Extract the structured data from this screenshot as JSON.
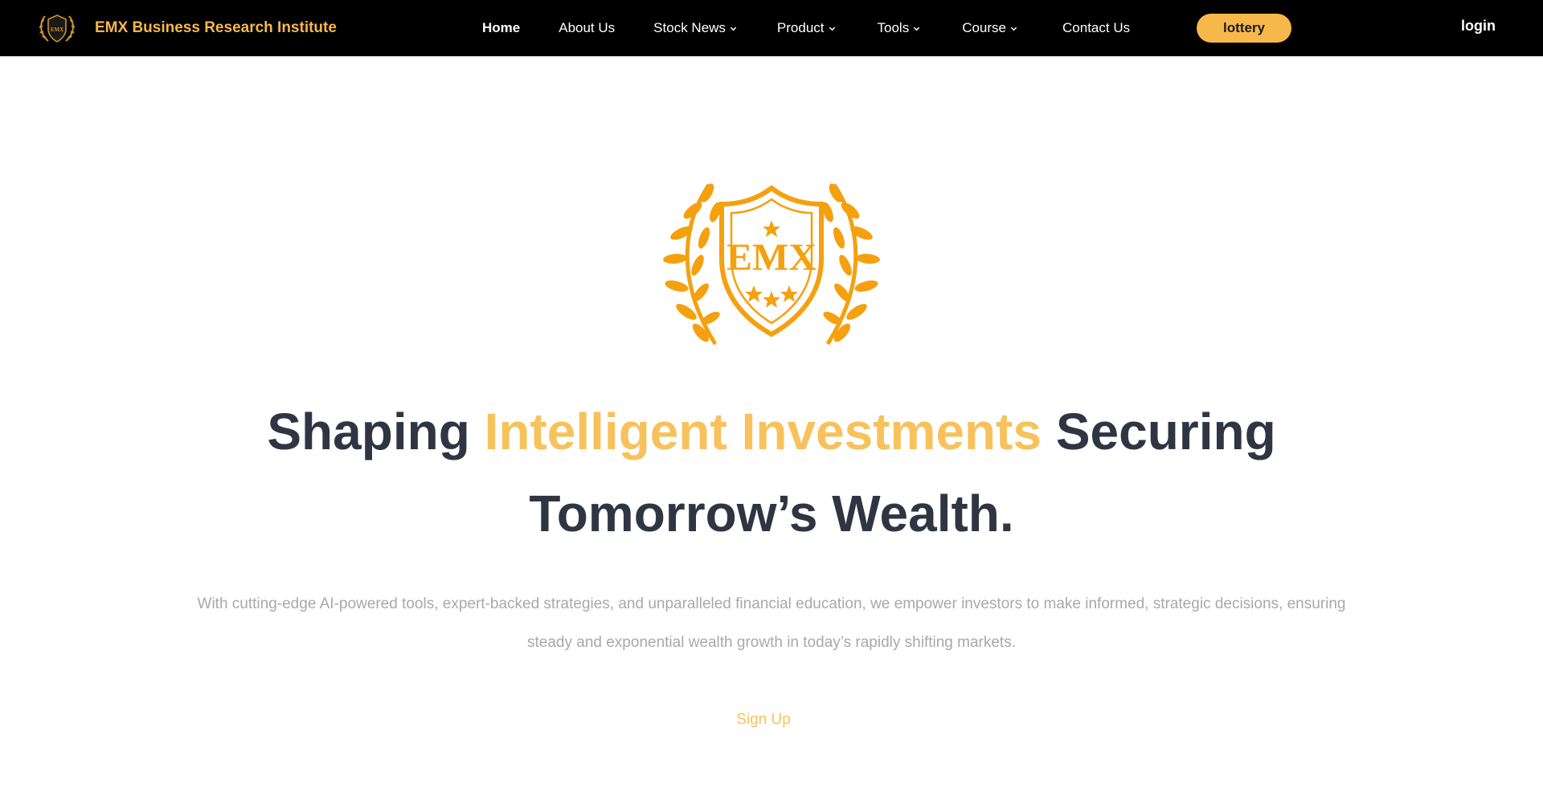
{
  "header": {
    "brand_name": "EMX Business Research Institute",
    "logo_icon": "emx-laurel-shield-icon",
    "nav": [
      {
        "label": "Home",
        "active": true,
        "has_dropdown": false
      },
      {
        "label": "About Us",
        "active": false,
        "has_dropdown": false
      },
      {
        "label": "Stock News",
        "active": false,
        "has_dropdown": true
      },
      {
        "label": "Product",
        "active": false,
        "has_dropdown": true
      },
      {
        "label": "Tools",
        "active": false,
        "has_dropdown": true
      },
      {
        "label": "Course",
        "active": false,
        "has_dropdown": true
      },
      {
        "label": "Contact Us",
        "active": false,
        "has_dropdown": false
      }
    ],
    "lottery_label": "lottery",
    "login_label": "login"
  },
  "hero": {
    "emblem_text": "EMX",
    "headline_part1": "Shaping ",
    "headline_accent": "Intelligent Investments",
    "headline_part2": " Securing Tomorrow’s Wealth.",
    "subtext": "With cutting-edge AI-powered tools, expert-backed strategies, and unparalleled financial education, we empower investors to make informed, strategic decisions, ensuring steady and exponential wealth growth in today’s rapidly shifting markets.",
    "signup_label": "Sign Up"
  },
  "colors": {
    "header_bg": "#000000",
    "brand_gold": "#f7b84b",
    "accent_gold": "#f7c25c",
    "emblem_orange": "#f5a00f",
    "headline_dark": "#2f3542",
    "subtext_gray": "#a8a8ae"
  }
}
